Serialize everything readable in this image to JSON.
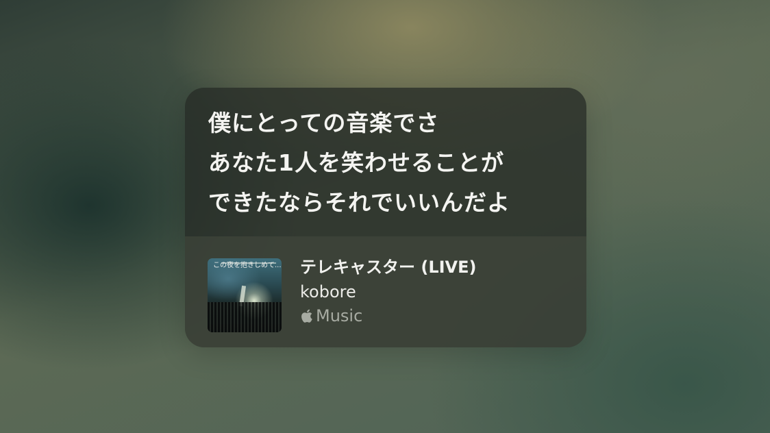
{
  "lyrics": {
    "lines": [
      "僕にとっての音楽でさ",
      "あなた1人を笑わせることが",
      "できたならそれでいいんだよ"
    ]
  },
  "track": {
    "title": "テレキャスター (LIVE)",
    "artist": "kobore",
    "source_label": "Music",
    "source_icon": "apple-logo-icon",
    "artwork": {
      "caption": "この夜を抱きしめて..."
    }
  },
  "colors": {
    "lyric_text": "#f4f4f1",
    "title_text": "#f2f2ef",
    "source_text": "#a7aba2",
    "card_bg": "#262c26"
  }
}
